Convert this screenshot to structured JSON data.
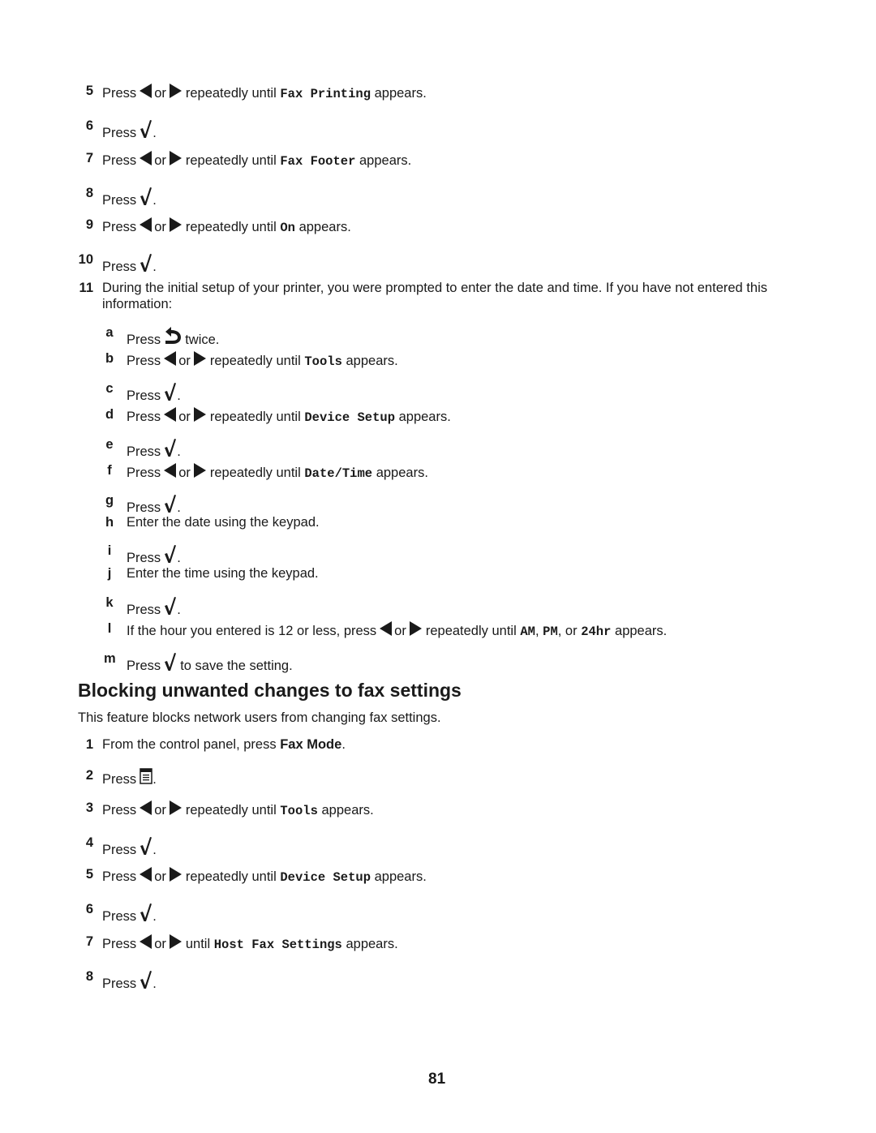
{
  "top_steps": [
    {
      "num": "5",
      "pre": "Press",
      "mid": "or",
      "post": "repeatedly until",
      "code": "Fax Printing",
      "end": "appears."
    },
    {
      "num": "6",
      "pre": "Press",
      "end": "."
    },
    {
      "num": "7",
      "pre": "Press",
      "mid": "or",
      "post": "repeatedly until",
      "code": "Fax Footer",
      "end": "appears."
    },
    {
      "num": "8",
      "pre": "Press",
      "end": "."
    },
    {
      "num": "9",
      "pre": "Press",
      "mid": "or",
      "post": "repeatedly until",
      "code": "On",
      "end": "appears."
    },
    {
      "num": "10",
      "pre": "Press",
      "end": "."
    },
    {
      "num": "11",
      "line1": "During the initial setup of your printer, you were prompted to enter the date and time. If you have not entered this",
      "line2": "information:"
    }
  ],
  "substeps": [
    {
      "letter": "a",
      "pre": "Press",
      "end": "twice.",
      "icon": "back-icon"
    },
    {
      "letter": "b",
      "pre": "Press",
      "mid": "or",
      "post": "repeatedly until",
      "code": "Tools",
      "end": "appears."
    },
    {
      "letter": "c",
      "pre": "Press",
      "end": "."
    },
    {
      "letter": "d",
      "pre": "Press",
      "mid": "or",
      "post": "repeatedly until",
      "code": "Device Setup",
      "end": "appears."
    },
    {
      "letter": "e",
      "pre": "Press",
      "end": "."
    },
    {
      "letter": "f",
      "pre": "Press",
      "mid": "or",
      "post": "repeatedly until",
      "code": "Date/Time",
      "end": "appears."
    },
    {
      "letter": "g",
      "pre": "Press",
      "end": "."
    },
    {
      "letter": "h",
      "text": "Enter the date using the keypad."
    },
    {
      "letter": "i",
      "pre": "Press",
      "end": "."
    },
    {
      "letter": "j",
      "text": "Enter the time using the keypad."
    },
    {
      "letter": "k",
      "pre": "Press",
      "end": "."
    },
    {
      "letter": "l",
      "pre": "If the hour you entered is 12 or less, press",
      "mid": "or",
      "post": "repeatedly until",
      "code1": "AM",
      "sep1": ",",
      "code2": "PM",
      "sep2": ", or",
      "code3": "24hr",
      "end": "appears."
    },
    {
      "letter": "m",
      "pre": "Press",
      "end": "to save the setting."
    }
  ],
  "section": {
    "heading": "Blocking unwanted changes to fax settings",
    "intro": "This feature blocks network users from changing fax settings.",
    "steps": [
      {
        "num": "1",
        "pre": "From the control panel, press",
        "bold": "Fax Mode",
        "end": "."
      },
      {
        "num": "2",
        "pre": "Press",
        "end": ".",
        "icon": "menu-icon"
      },
      {
        "num": "3",
        "pre": "Press",
        "mid": "or",
        "post": "repeatedly until",
        "code": "Tools",
        "end": "appears."
      },
      {
        "num": "4",
        "pre": "Press",
        "end": "."
      },
      {
        "num": "5",
        "pre": "Press",
        "mid": "or",
        "post": "repeatedly until",
        "code": "Device Setup",
        "end": "appears."
      },
      {
        "num": "6",
        "pre": "Press",
        "end": "."
      },
      {
        "num": "7",
        "pre": "Press",
        "mid": "or",
        "post": "until",
        "code": "Host Fax Settings",
        "end": "appears."
      },
      {
        "num": "8",
        "pre": "Press",
        "end": "."
      }
    ]
  },
  "footer": {
    "page_number": "81"
  }
}
